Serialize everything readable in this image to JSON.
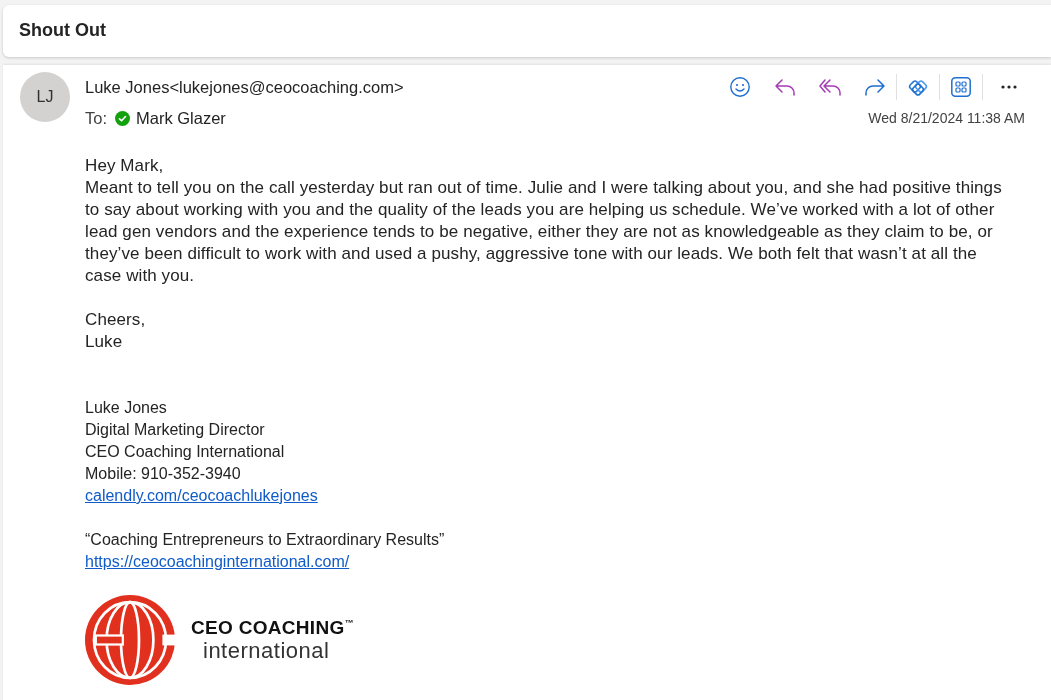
{
  "conversation": {
    "subject": "Shout Out"
  },
  "message": {
    "avatar": {
      "initials": "LJ"
    },
    "sender": "Luke Jones<lukejones@ceocoaching.com>",
    "to_label": "To:",
    "recipients": [
      {
        "name": "Mark Glazer"
      }
    ],
    "date": "Wed 8/21/2024 11:38 AM",
    "body": {
      "greeting": "Hey Mark,",
      "paragraph": "Meant to tell you on the call yesterday but ran out of time. Julie and I were talking about you, and she had positive things to say about working with you and the quality of the leads you are helping us schedule. We’ve worked with a lot of other lead gen vendors and the experience tends to be negative, either they are not as knowledgeable as they claim to be, or they’ve been difficult to work with and used a pushy, aggressive tone with our leads. We both felt that wasn’t at all the case with you.",
      "closing": "Cheers,",
      "signoff": "Luke"
    },
    "signature": {
      "lines": [
        {
          "kind": "text",
          "text": "Luke Jones"
        },
        {
          "kind": "text",
          "text": "Digital Marketing Director"
        },
        {
          "kind": "text",
          "text": "CEO Coaching International"
        },
        {
          "kind": "text",
          "text": "Mobile: 910-352-3940"
        },
        {
          "kind": "link",
          "text": "calendly.com/ceocoachlukejones"
        }
      ],
      "quote": "“Coaching Entrepreneurs to Extraordinary Results”",
      "website": "https://ceocoachinginternational.com/"
    },
    "logo": {
      "wordmark": "CEO COACHING$^{™}$",
      "subline": "international"
    }
  }
}
